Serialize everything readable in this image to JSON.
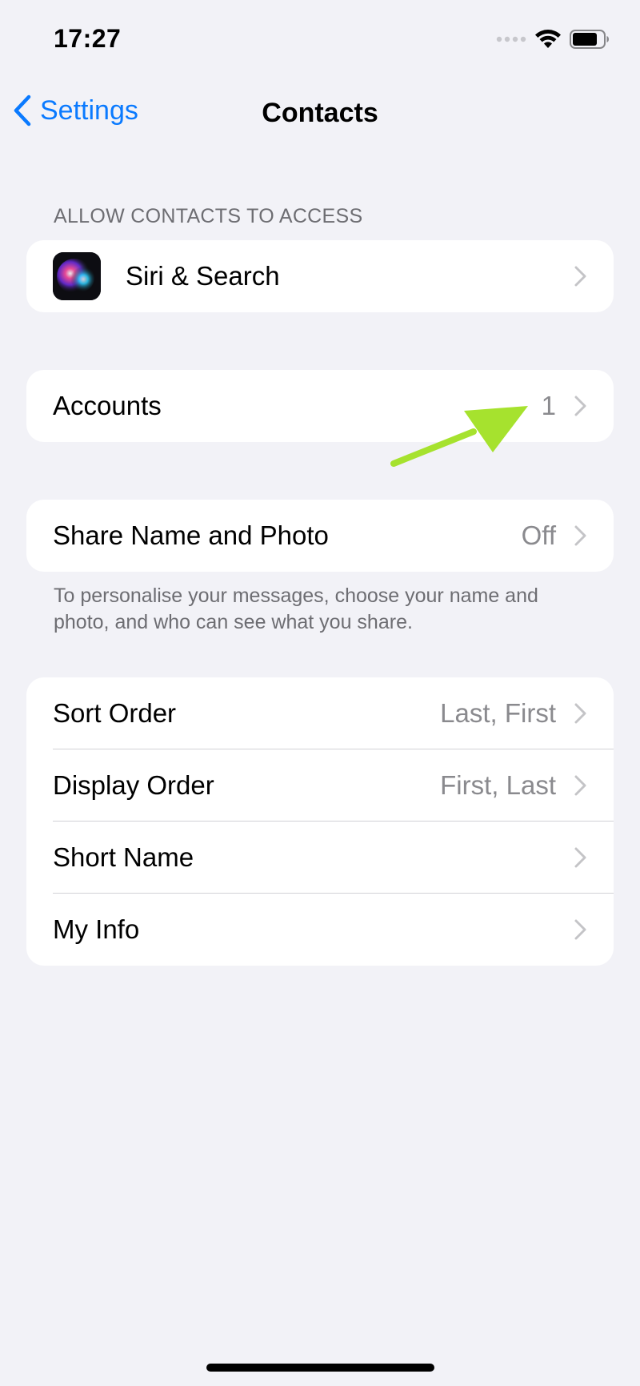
{
  "status_bar": {
    "time": "17:27",
    "icons": [
      "signal-icon",
      "wifi-icon",
      "battery-icon"
    ]
  },
  "nav": {
    "back_label": "Settings",
    "title": "Contacts"
  },
  "section_allow": {
    "header": "ALLOW CONTACTS TO ACCESS",
    "items": [
      {
        "label": "Siri & Search",
        "icon": "siri-icon"
      }
    ]
  },
  "accounts": {
    "label": "Accounts",
    "value": "1"
  },
  "share": {
    "label": "Share Name and Photo",
    "value": "Off",
    "footnote": "To personalise your messages, choose your name and photo, and who can see what you share."
  },
  "settings_group": {
    "items": [
      {
        "label": "Sort Order",
        "value": "Last, First"
      },
      {
        "label": "Display Order",
        "value": "First, Last"
      },
      {
        "label": "Short Name",
        "value": ""
      },
      {
        "label": "My Info",
        "value": ""
      }
    ]
  },
  "colors": {
    "background": "#f2f2f7",
    "accent": "#0a7aff",
    "secondary_text": "#8a8a8e",
    "annotation": "#a6e22e"
  }
}
